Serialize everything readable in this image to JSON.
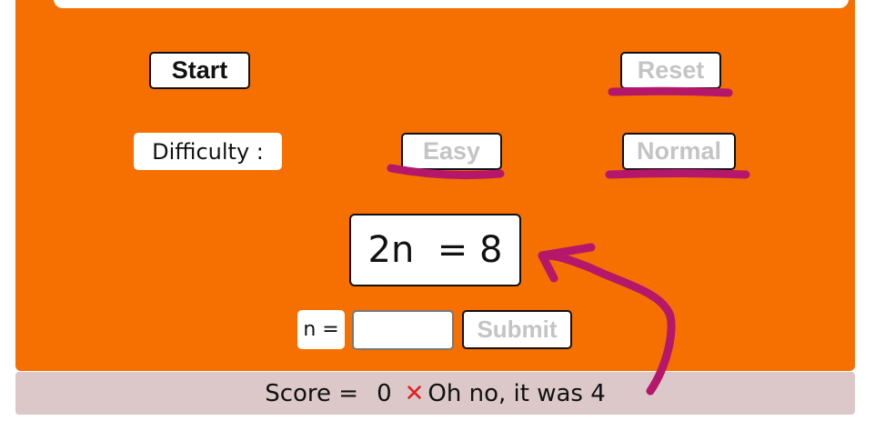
{
  "controls": {
    "start_label": "Start",
    "reset_label": "Reset"
  },
  "difficulty": {
    "label": "Difficulty :",
    "easy_label": "Easy",
    "normal_label": "Normal"
  },
  "problem": {
    "equation": "2n  = 8"
  },
  "answer": {
    "variable_label": "n =",
    "value": "",
    "submit_label": "Submit"
  },
  "status": {
    "score_label": "Score =",
    "score_value": "0",
    "result_icon": "cross-icon",
    "message": "Oh no, it was 4"
  },
  "colors": {
    "panel": "#f57000",
    "status_bar": "#dcc8c9",
    "annotation": "#b5176b",
    "cross": "#e02020",
    "disabled_text": "#c4c4c4"
  }
}
